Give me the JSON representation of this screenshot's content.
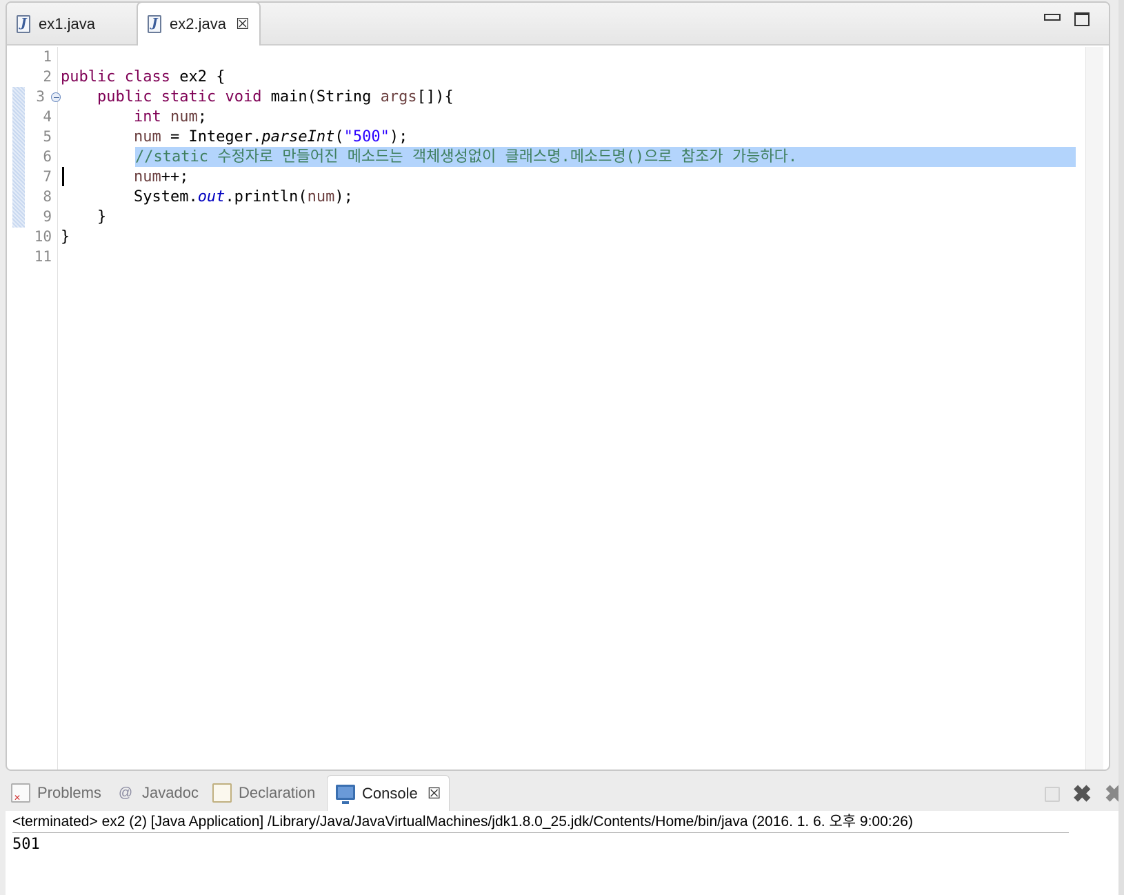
{
  "editor": {
    "tabs": [
      {
        "label": "ex1.java",
        "active": false
      },
      {
        "label": "ex2.java",
        "active": true
      }
    ],
    "tab_close_glyph": "☒",
    "line_numbers": [
      "1",
      "2",
      "3",
      "4",
      "5",
      "6",
      "7",
      "8",
      "9",
      "10",
      "11"
    ],
    "code": {
      "l2": {
        "kw1": "public",
        "kw2": "class",
        "rest": " ex2 {"
      },
      "l3": {
        "kw1": "public",
        "kw2": "static",
        "kw3": "void",
        "rest1": " main(String ",
        "var": "args",
        "rest2": "[]){"
      },
      "l4": {
        "kw": "int",
        "var": "num",
        "rest": ";"
      },
      "l5": {
        "var": "num",
        "rest1": " = Integer.",
        "method": "parseInt",
        "rest2": "(",
        "str": "\"500\"",
        "rest3": ");"
      },
      "l6": {
        "comment": "//static 수정자로 만들어진 메소드는 객체생성없이 클래스명.메소드명()으로 참조가 가능하다."
      },
      "l7": {
        "var": "num",
        "rest": "++;"
      },
      "l8": {
        "rest1": "System.",
        "field": "out",
        "rest2": ".println(",
        "var": "num",
        "rest3": ");"
      },
      "l9": {
        "text": "}"
      },
      "l10": {
        "text": "}"
      }
    },
    "selected_line": 6,
    "caret_line": 7
  },
  "console_view": {
    "tabs": [
      {
        "label": "Problems",
        "icon": "problems-icon",
        "active": false
      },
      {
        "label": "Javadoc",
        "icon": "javadoc-icon",
        "active": false
      },
      {
        "label": "Declaration",
        "icon": "declaration-icon",
        "active": false
      },
      {
        "label": "Console",
        "icon": "console-icon",
        "active": true
      }
    ],
    "javadoc_glyph": "@",
    "header": "<terminated> ex2 (2) [Java Application] /Library/Java/JavaVirtualMachines/jdk1.8.0_25.jdk/Contents/Home/bin/java (2016. 1. 6. 오후 9:00:26)",
    "output": "501"
  },
  "colors": {
    "keyword": "#7f0055",
    "string": "#2a00ff",
    "comment": "#3f7f5f",
    "field": "#0000c0",
    "variable": "#6a3e3e",
    "selection": "#b3d4fc"
  }
}
